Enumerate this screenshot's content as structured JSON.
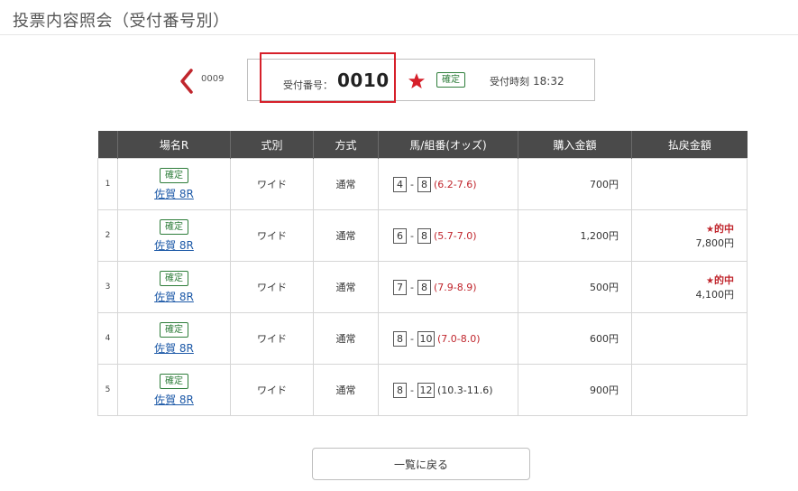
{
  "page": {
    "title": "投票内容照会（受付番号別）"
  },
  "navigation": {
    "prev_receipt_number": "0009"
  },
  "receipt": {
    "number_label": "受付番号：",
    "number": "0010",
    "status_badge": "確定",
    "time_label": "受付時刻",
    "time": "18:32"
  },
  "colors": {
    "accent_red": "#d6202a",
    "header_bg": "#4a4a4a",
    "badge_green": "#2e7d3a",
    "link_blue": "#1e5aa8"
  },
  "table": {
    "headers": [
      "",
      "場名R",
      "式別",
      "方式",
      "馬/組番(オッズ)",
      "購入金額",
      "払戻金額"
    ],
    "rows": [
      {
        "index": "1",
        "badge": "確定",
        "venue": "佐賀 8R",
        "bet_type": "ワイド",
        "method": "通常",
        "horse_a": "4",
        "horse_b": "8",
        "odds": "(6.2-7.6)",
        "odds_red": true,
        "amount": "700円",
        "hit": "",
        "payout": ""
      },
      {
        "index": "2",
        "badge": "確定",
        "venue": "佐賀 8R",
        "bet_type": "ワイド",
        "method": "通常",
        "horse_a": "6",
        "horse_b": "8",
        "odds": "(5.7-7.0)",
        "odds_red": true,
        "amount": "1,200円",
        "hit": "的中",
        "payout": "7,800円"
      },
      {
        "index": "3",
        "badge": "確定",
        "venue": "佐賀 8R",
        "bet_type": "ワイド",
        "method": "通常",
        "horse_a": "7",
        "horse_b": "8",
        "odds": "(7.9-8.9)",
        "odds_red": true,
        "amount": "500円",
        "hit": "的中",
        "payout": "4,100円"
      },
      {
        "index": "4",
        "badge": "確定",
        "venue": "佐賀 8R",
        "bet_type": "ワイド",
        "method": "通常",
        "horse_a": "8",
        "horse_b": "10",
        "odds": "(7.0-8.0)",
        "odds_red": true,
        "amount": "600円",
        "hit": "",
        "payout": ""
      },
      {
        "index": "5",
        "badge": "確定",
        "venue": "佐賀 8R",
        "bet_type": "ワイド",
        "method": "通常",
        "horse_a": "8",
        "horse_b": "12",
        "odds": "(10.3-11.6)",
        "odds_red": false,
        "amount": "900円",
        "hit": "",
        "payout": ""
      }
    ]
  },
  "footer": {
    "back_label": "一覧に戻る"
  }
}
